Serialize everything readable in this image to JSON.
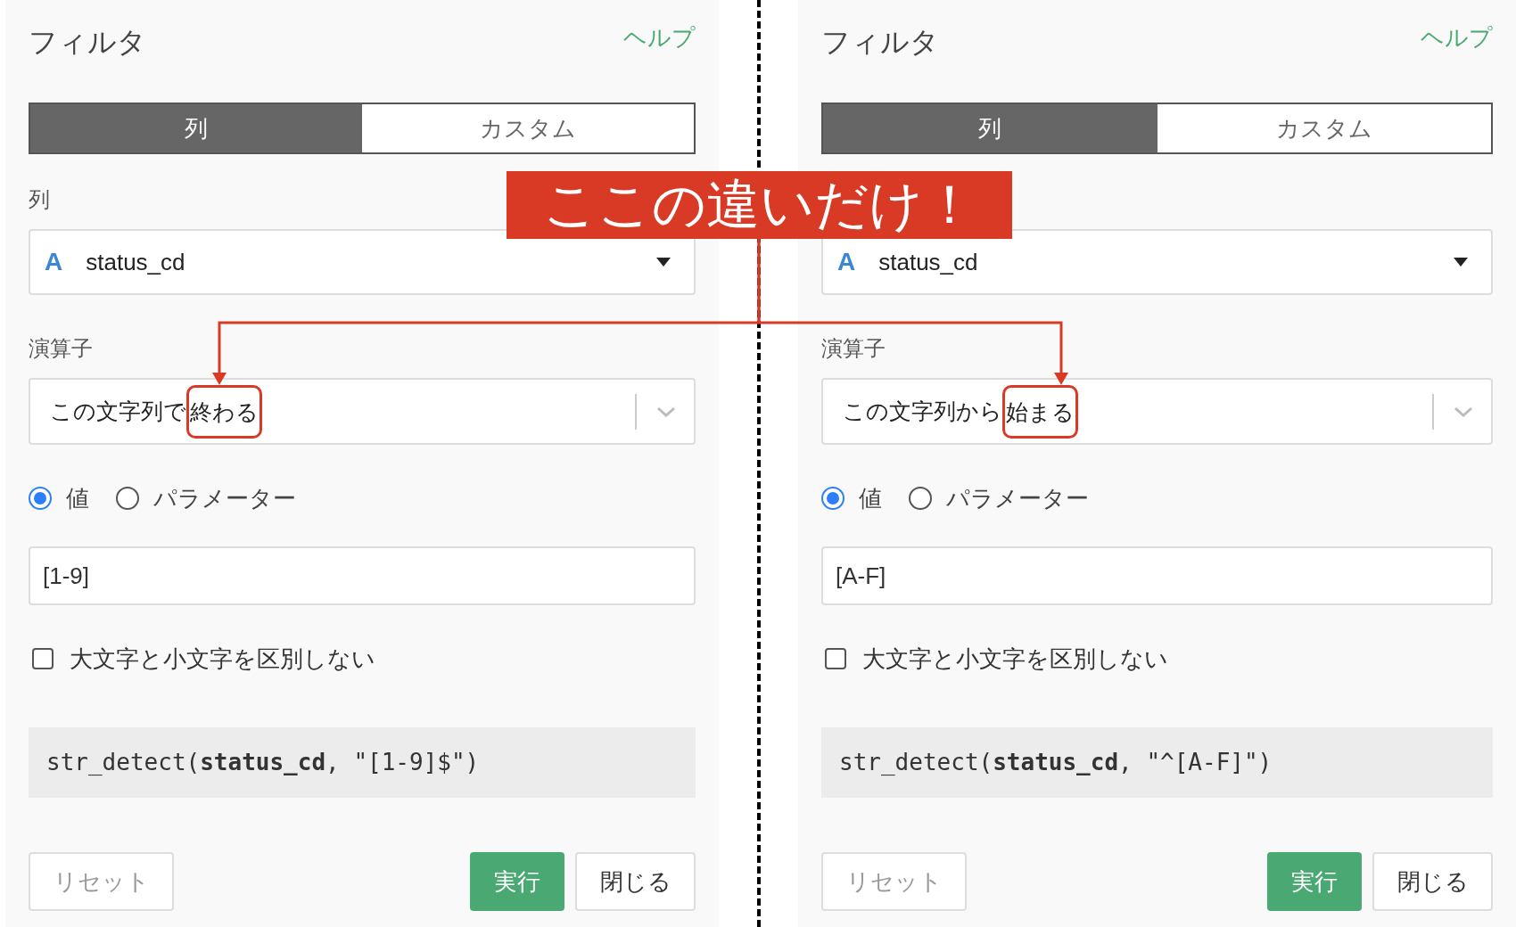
{
  "panels": [
    {
      "title": "フィルタ",
      "help": "ヘルプ",
      "tabs": [
        {
          "label": "列",
          "selected": true
        },
        {
          "label": "カスタム",
          "selected": false
        }
      ],
      "column_label": "列",
      "column_select": {
        "type_badge": "A",
        "value": "status_cd"
      },
      "operator_label": "演算子",
      "operator_select": {
        "prefix": "この文字列で",
        "highlighted": "終わる"
      },
      "radios": [
        {
          "label": "値",
          "selected": true
        },
        {
          "label": "パラメーター",
          "selected": false
        }
      ],
      "value_input": "[1-9]",
      "checkbox": {
        "label": "大文字と小文字を区別しない",
        "checked": false
      },
      "code": "str_detect(**status_cd**, \"[1-9]$\")",
      "buttons": [
        {
          "kind": "reset",
          "label": "リセット"
        },
        {
          "kind": "run",
          "label": "実行"
        },
        {
          "kind": "close",
          "label": "閉じる"
        }
      ]
    },
    {
      "title": "フィルタ",
      "help": "ヘルプ",
      "tabs": [
        {
          "label": "列",
          "selected": true
        },
        {
          "label": "カスタム",
          "selected": false
        }
      ],
      "column_select": {
        "type_badge": "A",
        "value": "status_cd"
      },
      "operator_label": "演算子",
      "operator_select": {
        "prefix": "この文字列から",
        "highlighted": "始まる"
      },
      "radios": [
        {
          "label": "値",
          "selected": true
        },
        {
          "label": "パラメーター",
          "selected": false
        }
      ],
      "value_input": "[A-F]",
      "checkbox": {
        "label": "大文字と小文字を区別しない",
        "checked": false
      },
      "code": "str_detect(**status_cd**, \"^[A-F]\")",
      "buttons": [
        {
          "kind": "reset",
          "label": "リセット"
        },
        {
          "kind": "run",
          "label": "実行"
        },
        {
          "kind": "close",
          "label": "閉じる"
        }
      ]
    }
  ],
  "annotation": {
    "text": "ここの違いだけ！"
  }
}
